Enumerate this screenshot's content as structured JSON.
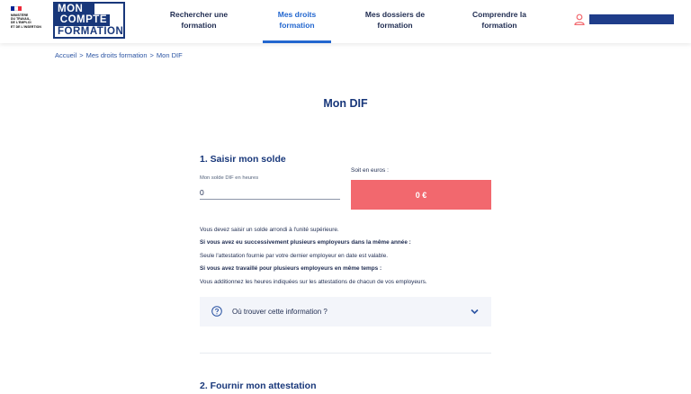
{
  "header": {
    "ministry_lines": [
      "MINISTÈRE",
      "DU TRAVAIL,",
      "DE L'EMPLOI",
      "ET DE L'INSERTION"
    ],
    "logo_lines": [
      "MON",
      "COMPTE",
      "FORMATION"
    ],
    "nav": [
      {
        "line1": "Rechercher une",
        "line2": "formation"
      },
      {
        "line1": "Mes droits",
        "line2": "formation"
      },
      {
        "line1": "Mes dossiers de",
        "line2": "formation"
      },
      {
        "line1": "Comprendre la",
        "line2": "formation"
      }
    ],
    "active_nav": "Mes droits formation",
    "user_icon": "user-icon"
  },
  "breadcrumb": [
    "Accueil",
    "Mes droits formation",
    "Mon DIF"
  ],
  "page_title": "Mon DIF",
  "section1": {
    "title": "1. Saisir mon solde",
    "input_label": "Mon solde DIF en heures",
    "input_value": "0",
    "euro_label": "Soit en euros :",
    "euro_value": "0 €"
  },
  "info_lines": [
    "Vous devez saisir un solde arrondi à l'unité supérieure.",
    "Si vous avez eu successivement plusieurs employeurs dans la même année :",
    "Seule l'attestation fournie par votre dernier employeur en date est valable.",
    "Si vous avez travaillé pour plusieurs employeurs en même temps :",
    "Vous additionnez les heures indiquées sur les attestations de chacun de vos employeurs."
  ],
  "accordion": {
    "label": "Où trouver cette information ?",
    "icon": "question-circle-icon",
    "chevron": "chevron-down-icon"
  },
  "section2": {
    "title": "2. Fournir mon attestation"
  },
  "colors": {
    "navy": "#18377a",
    "accent_blue": "#2367cf",
    "euro_box": "#f2686e",
    "accordion_bg": "#f3f5fa",
    "flag_blue": "#002395",
    "flag_red": "#ed2939"
  }
}
